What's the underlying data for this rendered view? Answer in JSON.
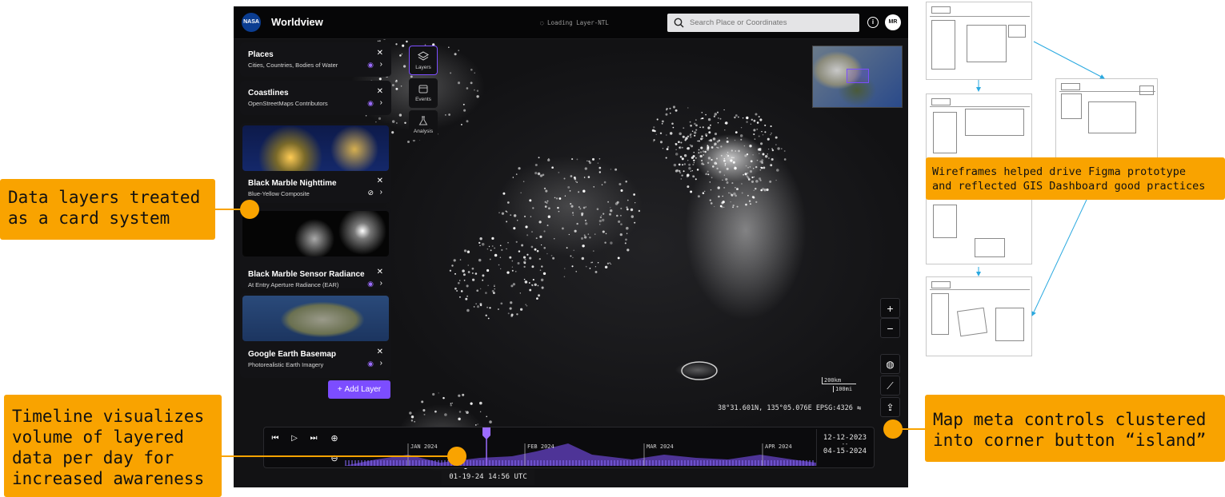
{
  "app": {
    "logo": "NASA",
    "title": "Worldview",
    "loading": "Loading Layer-NTL",
    "search_placeholder": "Search Place or Coordinates",
    "info": "i",
    "avatar": "MR"
  },
  "tools": [
    {
      "label": "Layers",
      "icon": "layers-icon"
    },
    {
      "label": "Events",
      "icon": "calendar-icon"
    },
    {
      "label": "Analysis",
      "icon": "flask-icon"
    }
  ],
  "layers": [
    {
      "title": "Places",
      "subtitle": "Cities, Countries, Bodies of Water",
      "visible": true
    },
    {
      "title": "Coastlines",
      "subtitle": "OpenStreetMaps Contributors",
      "visible": true
    },
    {
      "title": "Black Marble Nighttime",
      "subtitle": "Blue-Yellow Composite",
      "visible": false
    },
    {
      "title": "Black Marble Sensor Radiance",
      "subtitle": "At Entry Aperture Radiance (EAR)",
      "visible": true
    },
    {
      "title": "Google Earth Basemap",
      "subtitle": "Photorealistic Earth Imagery",
      "visible": true
    }
  ],
  "add_layer": "Add Layer",
  "add_layer_icon": "+",
  "map": {
    "scale_km": "200km",
    "scale_mi": "100mi",
    "coords": "38°31.601N, 135°05.076E EPSG:4326"
  },
  "timeline": {
    "months": [
      "JAN 2024",
      "FEB 2024",
      "MAR 2024",
      "APR 2024"
    ],
    "range_start": "12-12-2023",
    "range_sep": "--",
    "range_end": "04-15-2024",
    "current": "01-19-24 14:56 UTC"
  },
  "annotations": {
    "cards": "Data layers treated\nas a card system",
    "timeline": "Timeline visualizes\nvolume of layered\ndata per day for\nincreased awareness",
    "wireframes": "Wireframes helped drive Figma prototype\nand reflected GIS Dashboard good practices",
    "island": "Map meta controls clustered\ninto corner button “island”"
  },
  "colors": {
    "accent": "#7c4dff",
    "callout": "#f9a300",
    "arrow": "#2aa9e0"
  }
}
